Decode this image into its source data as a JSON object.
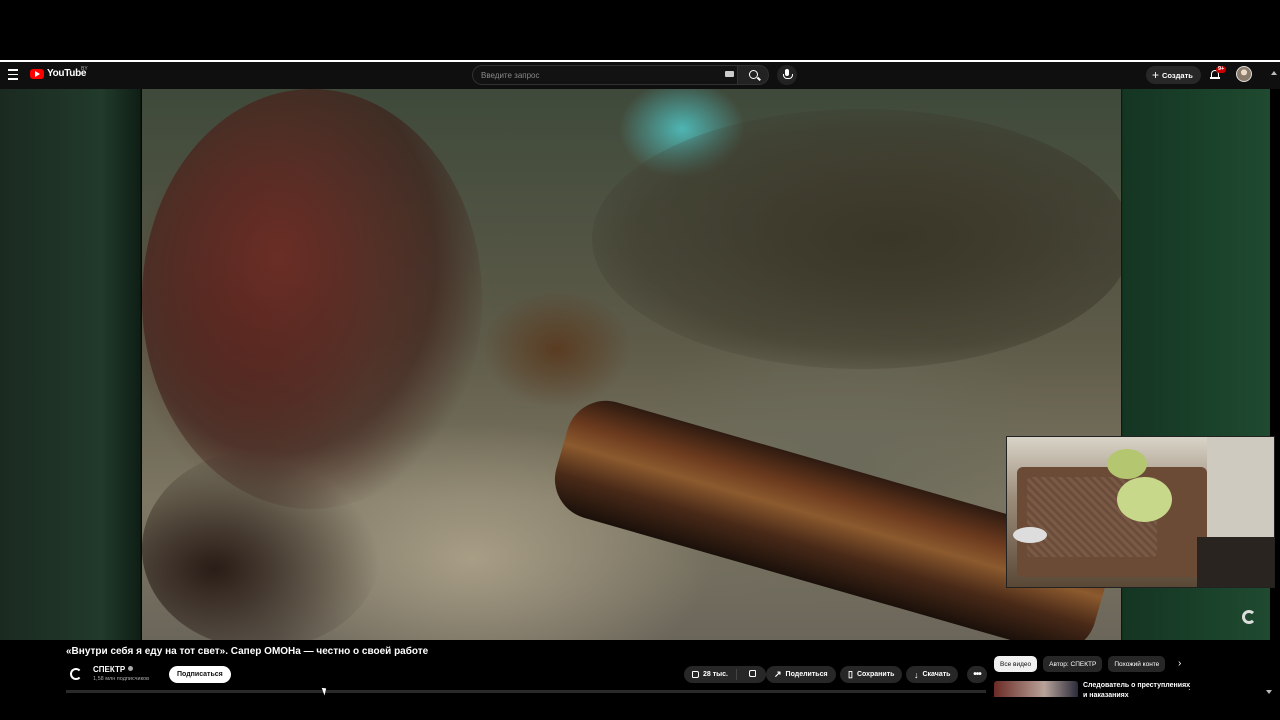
{
  "header": {
    "logo_text": "YouTube",
    "region": "BY",
    "search_placeholder": "Введите запрос",
    "create_label": "Создать",
    "notifications_badge": "9+"
  },
  "video": {
    "title": "«Внутри себя я еду на тот свет». Сапер ОМОНа — честно о своей работе"
  },
  "channel": {
    "name": "СПЕКТР",
    "subscribers": "1,58 млн подписчиков",
    "subscribe_label": "Подписаться"
  },
  "actions": {
    "likes": "28 тыс.",
    "share": "Поделиться",
    "save": "Сохранить",
    "download": "Скачать",
    "more": "•••"
  },
  "sidebar": {
    "chips": [
      "Все видео",
      "Автор: СПЕКТР",
      "Похожий конте"
    ],
    "related": [
      {
        "title_line1": "Следователь о преступлениях",
        "title_line2": "и наказаниях"
      }
    ]
  },
  "icons": {
    "menu": "hamburger-icon",
    "search": "search-icon",
    "mic": "microphone-icon",
    "notifications": "bell-icon",
    "like": "thumbs-up-icon",
    "dislike": "thumbs-down-icon",
    "share": "share-arrow-icon",
    "save": "bookmark-icon",
    "download": "download-icon"
  },
  "colors": {
    "brand": "#ff0000",
    "background": "#0f0f0f",
    "pill": "#272727",
    "subscribe_bg": "#ffffff"
  }
}
